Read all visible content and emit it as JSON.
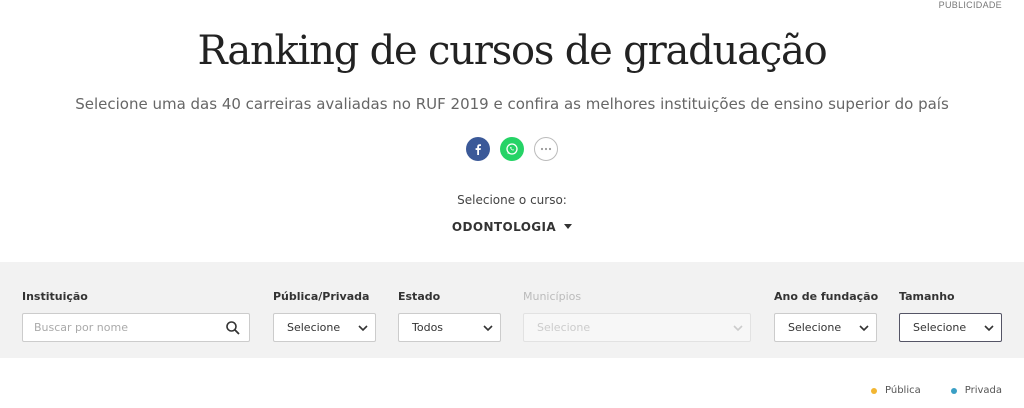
{
  "ad_label": "PUBLICIDADE",
  "title": "Ranking de cursos de graduação",
  "subtitle": "Selecione uma das 40 carreiras avaliadas no RUF 2019 e confira as melhores instituições de ensino superior do país",
  "share": {
    "icons": [
      "facebook-icon",
      "whatsapp-icon",
      "more-icon"
    ]
  },
  "course": {
    "label": "Selecione o curso:",
    "value": "ODONTOLOGIA"
  },
  "filters": {
    "institution": {
      "label": "Instituição",
      "placeholder": "Buscar por nome"
    },
    "public_private": {
      "label": "Pública/Privada",
      "value": "Selecione"
    },
    "state": {
      "label": "Estado",
      "value": "Todos"
    },
    "municipality": {
      "label": "Municípios",
      "value": "Selecione"
    },
    "foundation_year": {
      "label": "Ano de fundação",
      "value": "Selecione"
    },
    "size": {
      "label": "Tamanho",
      "value": "Selecione"
    }
  },
  "legend": [
    {
      "label": "Pública",
      "color": "#f2b632"
    },
    {
      "label": "Privada",
      "color": "#3a9fc5"
    }
  ]
}
